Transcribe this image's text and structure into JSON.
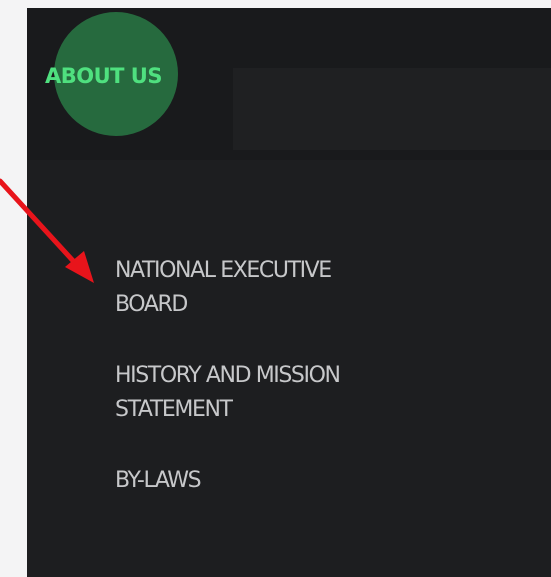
{
  "nav": {
    "about_label": "ABOUT US"
  },
  "submenu": {
    "items": [
      {
        "label": "NATIONAL EXECUTIVE BOARD"
      },
      {
        "label": "HISTORY AND MISSION STATEMENT"
      },
      {
        "label": "BY-LAWS"
      }
    ]
  },
  "colors": {
    "panel_background": "#1d1e20",
    "accent_green": "#4fe07f",
    "highlight_circle": "#266a3e",
    "menu_text": "#c7c8ca",
    "annotation_arrow": "#e8141b"
  },
  "annotation": {
    "icon": "red-arrow-icon",
    "target": "NATIONAL EXECUTIVE BOARD"
  }
}
